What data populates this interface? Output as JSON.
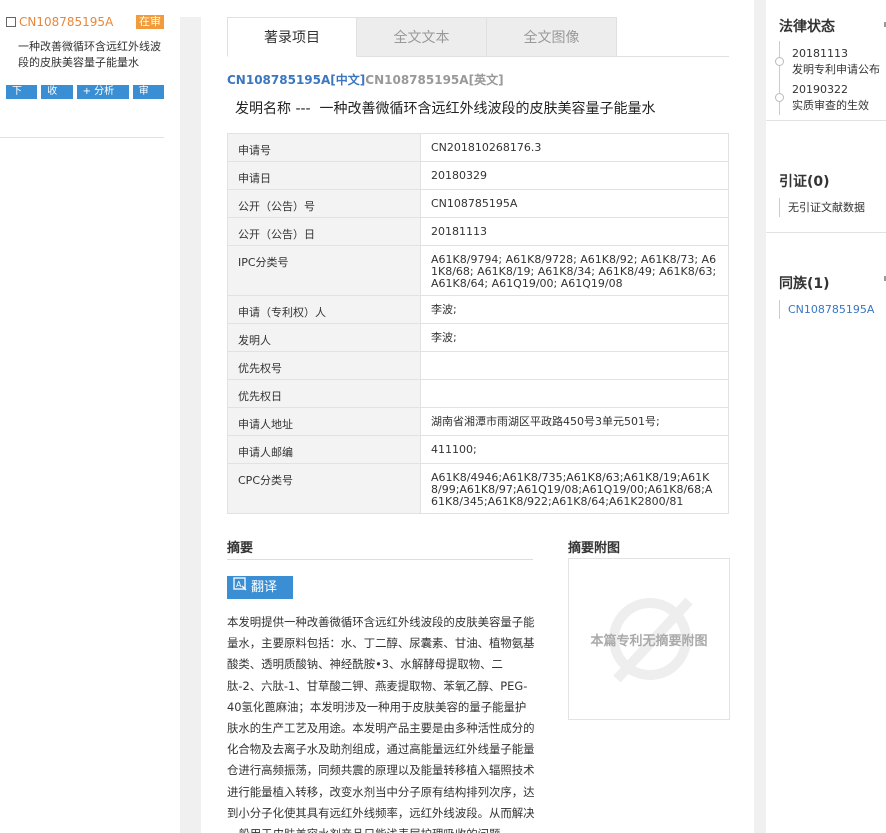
{
  "left": {
    "patent_number": "CN108785195A",
    "status": "在审",
    "title": "一种改善微循环含远红外线波段的皮肤美容量子能量水",
    "buttons": [
      "下载",
      "收藏",
      "+ 分析库",
      "审查"
    ]
  },
  "tabs": [
    "著录项目",
    "全文文本",
    "全文图像"
  ],
  "pub": {
    "zh_number": "CN108785195A",
    "zh_tag": "[中文]",
    "en_number": "CN108785195A",
    "en_tag": "[英文]"
  },
  "title_label": "发明名称 ---",
  "title_value": "一种改善微循环含远红外线波段的皮肤美容量子能量水",
  "biblio": [
    {
      "k": "申请号",
      "v": "CN201810268176.3"
    },
    {
      "k": "申请日",
      "v": "20180329"
    },
    {
      "k": "公开（公告）号",
      "v": "CN108785195A"
    },
    {
      "k": "公开（公告）日",
      "v": "20181113"
    },
    {
      "k": "IPC分类号",
      "v": "A61K8/9794; A61K8/9728; A61K8/92; A61K8/73; A61K8/68; A61K8/19; A61K8/34; A61K8/49; A61K8/63; A61K8/64; A61Q19/00; A61Q19/08"
    },
    {
      "k": "申请（专利权）人",
      "v": "李波;"
    },
    {
      "k": "发明人",
      "v": "李波;"
    },
    {
      "k": "优先权号",
      "v": ""
    },
    {
      "k": "优先权日",
      "v": ""
    },
    {
      "k": "申请人地址",
      "v": "湖南省湘潭市雨湖区平政路450号3单元501号;"
    },
    {
      "k": "申请人邮编",
      "v": "411100;"
    },
    {
      "k": "CPC分类号",
      "v": "A61K8/4946;A61K8/735;A61K8/63;A61K8/19;A61K8/99;A61K8/97;A61Q19/08;A61Q19/00;A61K8/68;A61K8/345;A61K8/922;A61K8/64;A61K2800/81"
    }
  ],
  "abstract": {
    "heading": "摘要",
    "translate_label": "翻译",
    "text": "本发明提供一种改善微循环含远红外线波段的皮肤美容量子能量水，主要原料包括：水、丁二醇、尿囊素、甘油、植物氨基酸类、透明质酸钠、神经酰胺•3、水解酵母提取物、二肽-2、六肽-1、甘草酸二钾、燕麦提取物、苯氧乙醇、PEG-40氢化蓖麻油；本发明涉及一种用于皮肤美容的量子能量护肤水的生产工艺及用途。本发明产品主要是由多种活性成分的化合物及去离子水及助剂组成，通过高能量远红外线量子能量仓进行高频振荡，同频共震的原理以及能量转移植入辐照技术进行能量植入转移，改变水剂当中分子原有结构排列次序，达到小分子化使其具有远红外线频率，远红外线波段。从而解决一般用于皮肤美容水剂产品只能浅表层护理吸收的问题。"
  },
  "figure": {
    "heading": "摘要附图",
    "placeholder": "本篇专利无摘要附图"
  },
  "right": {
    "legal_heading": "法律状态",
    "legal_events": [
      {
        "date": "20181113",
        "desc": "发明专利申请公布"
      },
      {
        "date": "20190322",
        "desc": "实质审查的生效"
      }
    ],
    "citation_heading": "引证(0)",
    "citation_empty": "无引证文献数据",
    "family_heading": "同族(1)",
    "family_members": [
      "CN108785195A"
    ]
  },
  "colors": {
    "accent": "#3a8ed3",
    "link": "#3a77c0",
    "orange": "#e8873a"
  }
}
